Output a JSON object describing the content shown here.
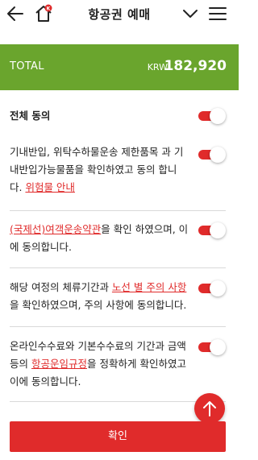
{
  "header": {
    "title": "항공권 예매",
    "back_icon": "arrow-left-icon",
    "home_icon": "home-icon",
    "chevron_icon": "chevron-down-icon",
    "menu_icon": "hamburger-menu-icon"
  },
  "total": {
    "label": "TOTAL",
    "currency": "KRW",
    "amount": "182,920",
    "bar_color": "#6aa52d"
  },
  "agreements": {
    "all": {
      "label": "전체 동의",
      "checked": true
    },
    "items": [
      {
        "text_before": "기내반입, 위탁수하물운송 제한품목 과 기내반입가능물품을 확인하였고 동의 합니다. ",
        "link": "위험물 안내",
        "text_after": "",
        "checked": true
      },
      {
        "text_before": "",
        "link": "(국제선)여객운송약관",
        "text_after": "을 확인 하였으며, 이에 동의합니다.",
        "checked": true
      },
      {
        "text_before": "해당 여정의 체류기간과 ",
        "link": "노선 별 주의 사항",
        "text_after": "을 확인하였으며, 주의 사항에 동의합니다.",
        "checked": true
      },
      {
        "text_before": "온라인수수료와 기본수수료의 기간과 금액 등의 ",
        "link": "항공운임규정",
        "text_after": "을 정확하게 확인하였고 이에 동의합니다.",
        "checked": true
      }
    ]
  },
  "confirm_label": "확인",
  "accent_color": "#e02b2b",
  "fab_icon": "arrow-up-icon"
}
